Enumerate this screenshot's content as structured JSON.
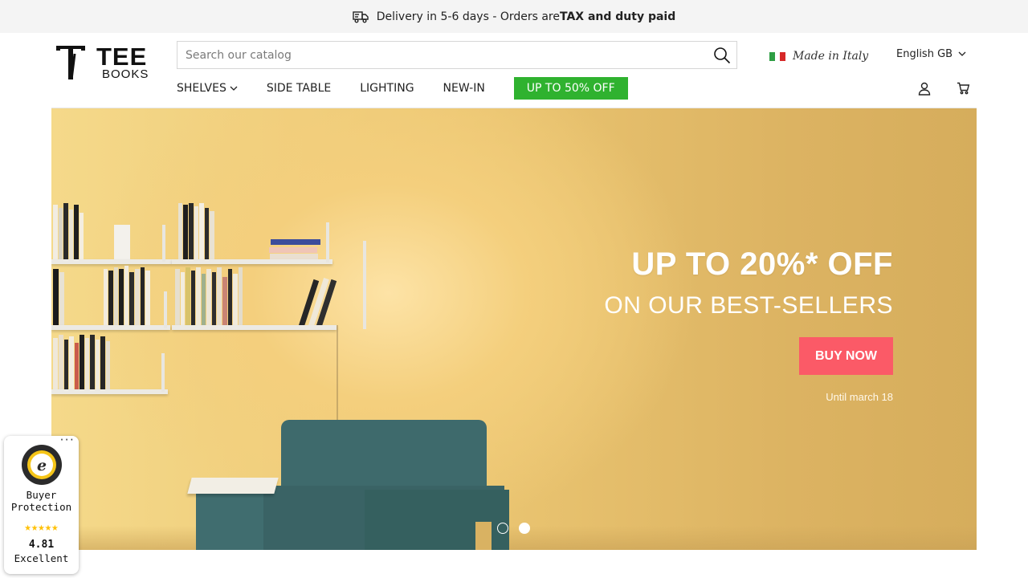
{
  "announcement": {
    "text_before": "Delivery in 5-6 days - Orders are ",
    "text_bold": "TAX and duty paid",
    "icon": "truck-icon"
  },
  "logo": {
    "word1": "TEE",
    "word2": "BOOKS"
  },
  "search": {
    "placeholder": "Search our catalog",
    "value": "",
    "icon": "search-icon"
  },
  "made_in": {
    "label": "Made in Italy",
    "flag_colors": [
      "#2f9e44",
      "#ffffff",
      "#d62828"
    ]
  },
  "language": {
    "selected": "English GB",
    "icon": "chevron-down-icon"
  },
  "nav": {
    "items": [
      {
        "label": "SHELVES",
        "has_dropdown": true
      },
      {
        "label": "SIDE TABLE",
        "has_dropdown": false
      },
      {
        "label": "LIGHTING",
        "has_dropdown": false
      },
      {
        "label": "NEW-IN",
        "has_dropdown": false
      }
    ],
    "sale_label": "UP TO 50% OFF",
    "sale_color": "#2fb22f"
  },
  "header_icons": [
    "user-icon",
    "cart-icon"
  ],
  "hero": {
    "headline": "UP TO 20%* OFF",
    "subheadline": "ON OUR BEST-SELLERS",
    "cta": "BUY NOW",
    "cta_color": "#fb5a67",
    "footnote": "Until march 18",
    "slides_total": 2,
    "active_slide": 2
  },
  "trust_badge": {
    "line1": "Buyer",
    "line2": "Protection",
    "stars": "★★★★★",
    "rating": "4.81",
    "grade": "Excellent",
    "menu": "···"
  }
}
